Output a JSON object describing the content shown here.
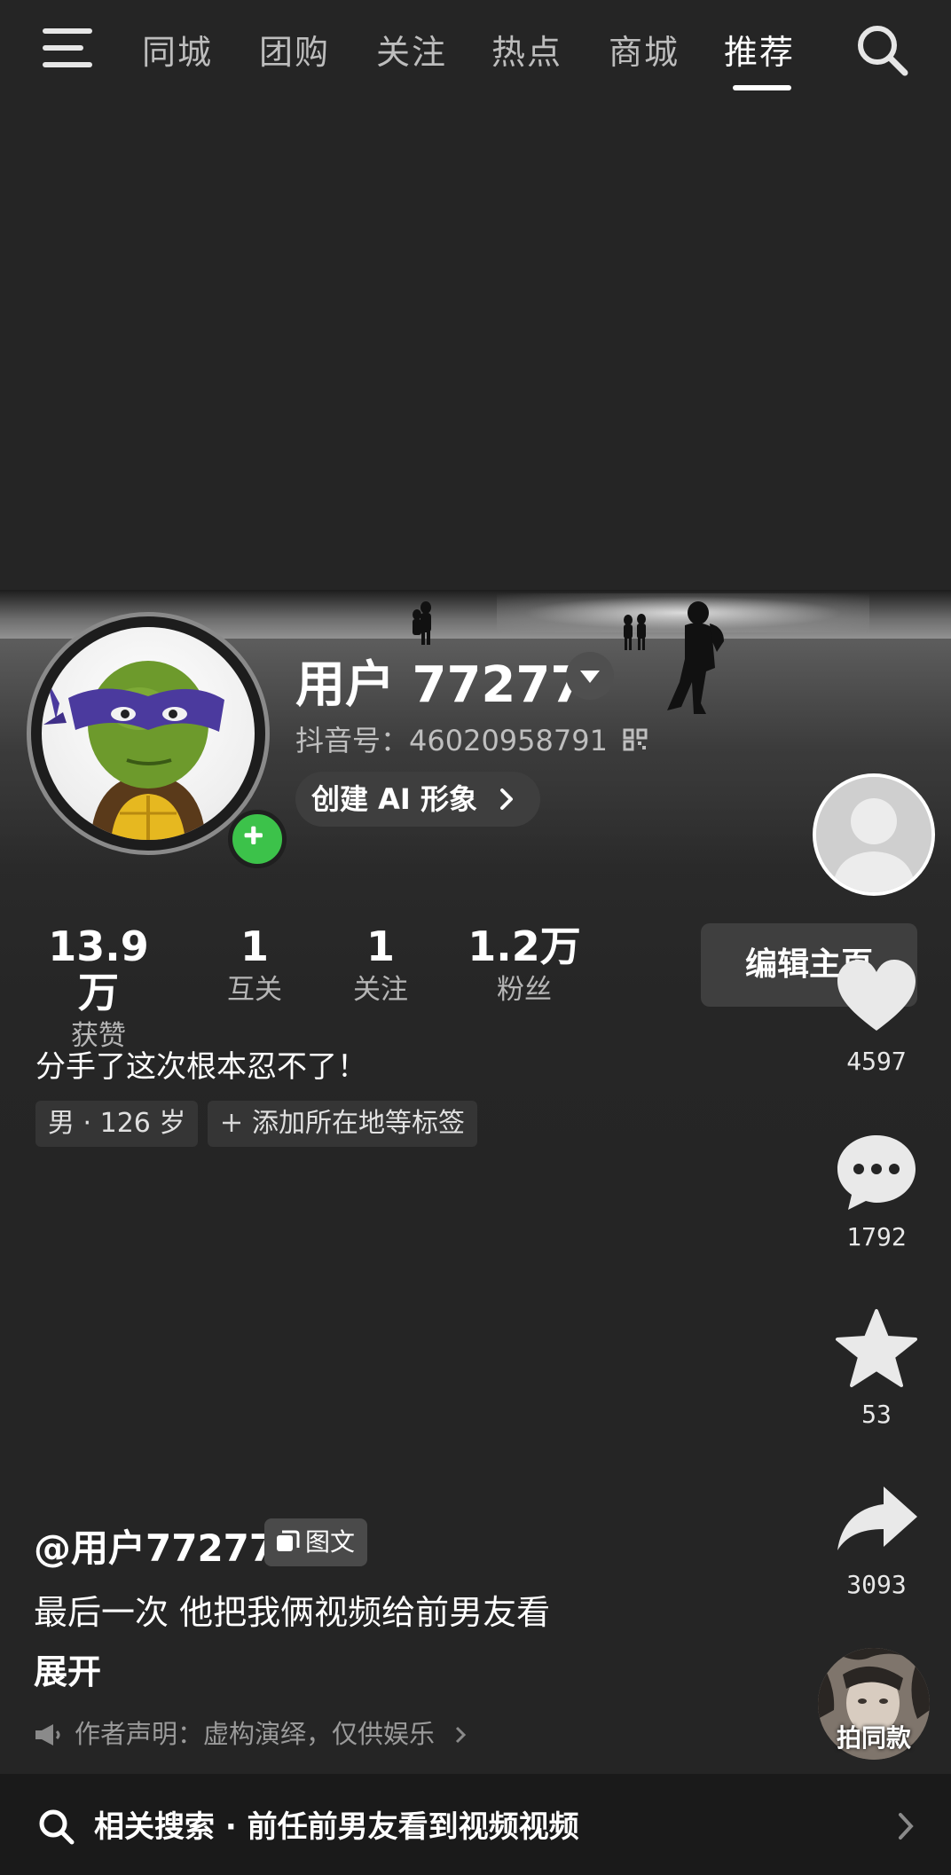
{
  "nav": {
    "tabs": [
      {
        "label": "同城"
      },
      {
        "label": "团购"
      },
      {
        "label": "关注"
      },
      {
        "label": "热点"
      },
      {
        "label": "商城"
      },
      {
        "label": "推荐"
      }
    ],
    "active_tab": "推荐"
  },
  "profile": {
    "username": "用户 77277",
    "douyin_id": "抖音号：46020958791",
    "ai_button": "创建 AI 形象",
    "edit_button": "编辑主页",
    "stats": [
      {
        "value": "13.9万",
        "label": "获赞"
      },
      {
        "value": "1",
        "label": "互关"
      },
      {
        "value": "1",
        "label": "关注"
      },
      {
        "value": "1.2万",
        "label": "粉丝"
      }
    ],
    "bio": "分手了这次根本忍不了！",
    "chips": {
      "gender_age": "男 · 126 岁",
      "add_tag": "添加所在地等标签"
    }
  },
  "rail": {
    "likes": "4597",
    "comments": "1792",
    "favorites": "53",
    "shares": "3093"
  },
  "post": {
    "author": "@用户77277",
    "type_badge": "图文",
    "caption": "最后一次  他把我俩视频给前男友看",
    "expand": "展开",
    "disclaimer": "作者声明：虚构演绎，仅供娱乐",
    "same_style": "拍同款"
  },
  "related_search": "相关搜索 · 前任前男友看到视频视频",
  "colors": {
    "add_badge": "#3cc24a",
    "background": "#252525"
  }
}
